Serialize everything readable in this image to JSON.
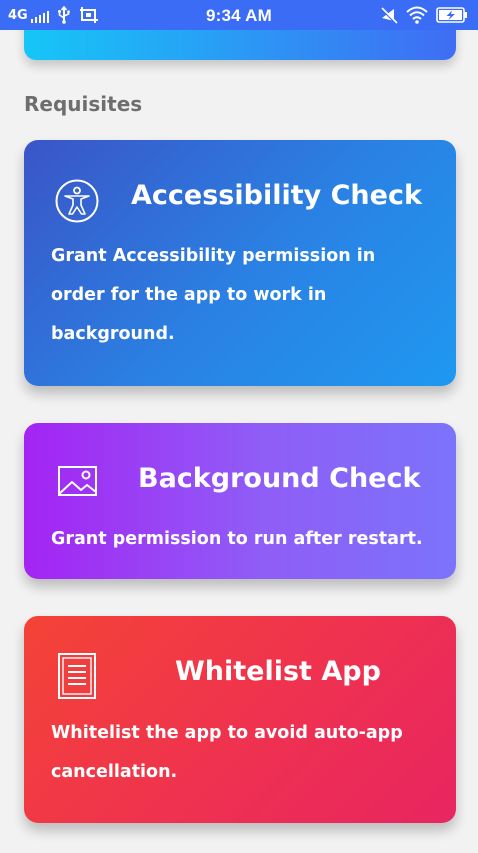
{
  "status_bar": {
    "network": "4G",
    "time": "9:34 AM",
    "icons": [
      "signal-icon",
      "usb-icon",
      "screenshot-icon",
      "mute-icon",
      "wifi-icon",
      "battery-charging-icon"
    ]
  },
  "section": {
    "title": "Requisites"
  },
  "cards": [
    {
      "icon": "accessibility-icon",
      "title": "Accessibility Check",
      "description": "Grant Accessibility permission in order for the app to work in background.",
      "gradient": [
        "#3a55c7",
        "#1e98f0"
      ]
    },
    {
      "icon": "image-icon",
      "title": "Background Check",
      "description": "Grant permission to run after restart.",
      "gradient": [
        "#a424f3",
        "#7c73fb"
      ]
    },
    {
      "icon": "document-list-icon",
      "title": "Whitelist App",
      "description": "Whitelist the app to avoid auto-app cancellation.",
      "gradient": [
        "#f44336",
        "#e82560"
      ]
    }
  ],
  "colors": {
    "status_bar": "#3b6cf5",
    "background": "#f2f2f2",
    "section_title": "#6e6e6e"
  }
}
